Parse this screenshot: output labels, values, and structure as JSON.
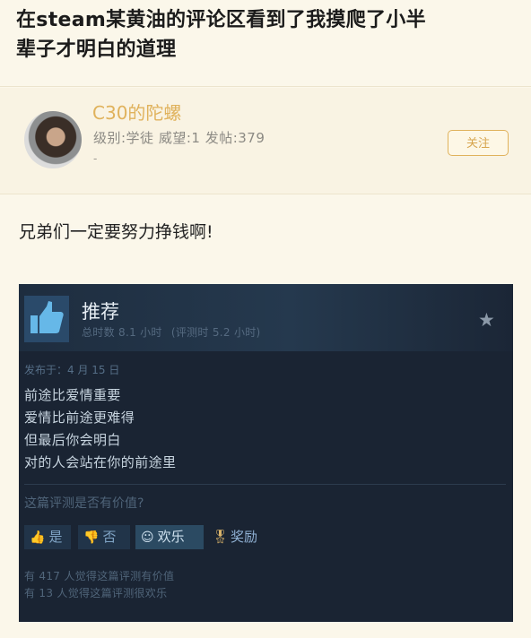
{
  "post": {
    "title_line1": "在steam某黄油的评论区看到了我摸爬了小半",
    "title_line2": "辈子才明白的道理",
    "text": "兄弟们一定要努力挣钱啊!"
  },
  "user": {
    "name": "C30的陀螺",
    "meta": "级别:学徒 威望:1 发帖:379",
    "meta_extra": "-",
    "follow_label": "关注"
  },
  "review": {
    "verdict": "推荐",
    "hours_total": "总时数 8.1 小时",
    "hours_review": "(评测时 5.2 小时)",
    "posted": "发布于：4 月 15 日",
    "lines": [
      "前途比爱情重要",
      "爱情比前途更难得",
      "但最后你会明白",
      "对的人会站在你的前途里"
    ],
    "helpful_question": "这篇评测是否有价值?",
    "vote_yes": "是",
    "vote_no": "否",
    "vote_funny": "欢乐",
    "award": "奖励",
    "count_helpful": "有 417 人觉得这篇评测有价值",
    "count_funny": "有 13 人觉得这篇评测很欢乐",
    "colors": {
      "background": "#1a2433",
      "header": "#25394e",
      "thumb": "#2a4a6a",
      "award": "#d9b36a"
    }
  },
  "icons": [
    "thumbs-up-icon",
    "star-icon",
    "thumbs-down-icon",
    "smiley-icon",
    "award-icon"
  ],
  "colors": {
    "page_background": "#fbf7ea",
    "username": "#e0b25c"
  }
}
